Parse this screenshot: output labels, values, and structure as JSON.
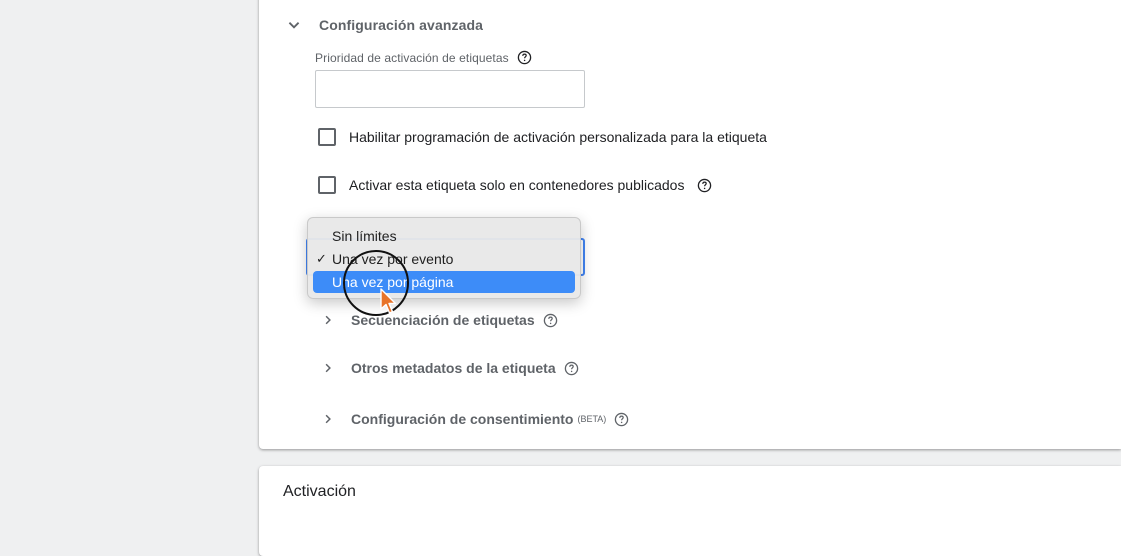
{
  "advanced": {
    "title": "Configuración avanzada",
    "priority_label": "Prioridad de activación de etiquetas",
    "priority_value": "",
    "custom_schedule_label": "Habilitar programación de activación personalizada para la etiqueta",
    "published_only_label": "Activar esta etiqueta solo en contenedores publicados"
  },
  "firing_options": {
    "options": [
      {
        "label": "Sin límites",
        "checked": false
      },
      {
        "label": "Una vez por evento",
        "checked": true
      },
      {
        "label": "Una vez por página",
        "checked": false
      }
    ],
    "highlighted_index": 2,
    "check_mark": "✓"
  },
  "sections": [
    {
      "label": "Secuenciación de etiquetas"
    },
    {
      "label": "Otros metadatos de la etiqueta"
    },
    {
      "label": "Configuración de consentimiento",
      "badge": "(BETA)"
    }
  ],
  "activation": {
    "title": "Activación"
  },
  "colors": {
    "accent": "#4285f4",
    "highlight": "#3d8cf8",
    "cursor": "#e8742a"
  }
}
